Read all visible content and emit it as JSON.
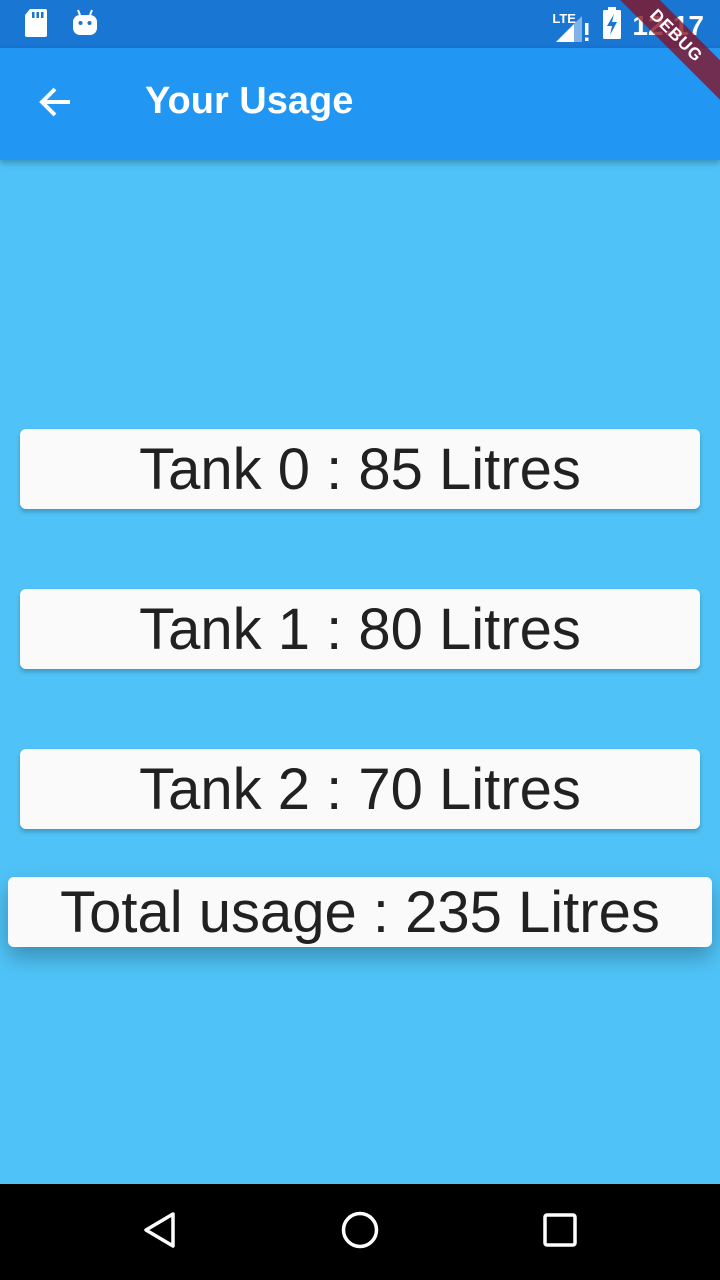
{
  "status_bar": {
    "time": "12:17",
    "network": "LTE",
    "icons": [
      "sd-card-icon",
      "android-icon",
      "signal-icon",
      "battery-charging-icon"
    ]
  },
  "debug_banner": "DEBUG",
  "app_bar": {
    "title": "Your Usage",
    "back_icon": "arrow-back-icon"
  },
  "tanks": [
    {
      "label": "Tank 0 : 85 Litres"
    },
    {
      "label": "Tank 1 : 80 Litres"
    },
    {
      "label": "Tank 2 : 70 Litres"
    }
  ],
  "total": {
    "label": "Total usage : 235 Litres"
  },
  "nav_bar": {
    "icons": [
      "back-triangle-icon",
      "home-circle-icon",
      "recents-square-icon"
    ]
  },
  "colors": {
    "status_bar": "#1976D2",
    "app_bar": "#2196F3",
    "background": "#4FC3F7",
    "card": "#FAFAFA",
    "debug": "#881122"
  }
}
